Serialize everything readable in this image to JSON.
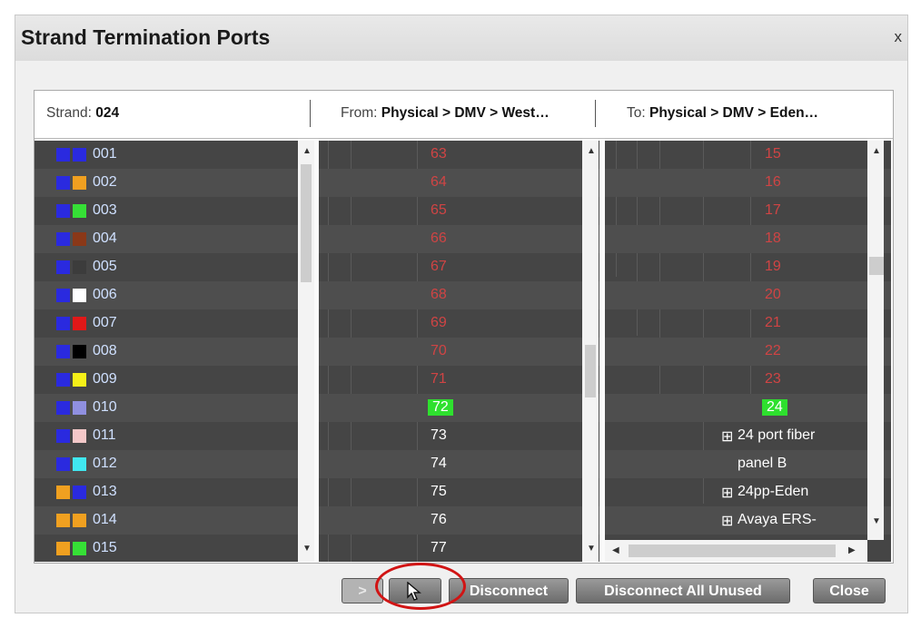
{
  "dialog": {
    "title": "Strand Termination Ports",
    "close_label": "x"
  },
  "header": {
    "strand_label": "Strand: ",
    "strand_value": "024",
    "from_label": "From: ",
    "from_value": "Physical > DMV > West…",
    "to_label": "To: ",
    "to_value": "Physical > DMV > Eden…"
  },
  "strands": [
    {
      "label": "001",
      "c1": "#2a2adf",
      "c2": "#2a2adf"
    },
    {
      "label": "002",
      "c1": "#2a2adf",
      "c2": "#f0a020"
    },
    {
      "label": "003",
      "c1": "#2a2adf",
      "c2": "#36e036"
    },
    {
      "label": "004",
      "c1": "#2a2adf",
      "c2": "#8a3818"
    },
    {
      "label": "005",
      "c1": "#2a2adf",
      "c2": "#3c3c3c"
    },
    {
      "label": "006",
      "c1": "#2a2adf",
      "c2": "#ffffff"
    },
    {
      "label": "007",
      "c1": "#2a2adf",
      "c2": "#e01818"
    },
    {
      "label": "008",
      "c1": "#2a2adf",
      "c2": "#000000"
    },
    {
      "label": "009",
      "c1": "#2a2adf",
      "c2": "#f6f018"
    },
    {
      "label": "010",
      "c1": "#2a2adf",
      "c2": "#9090e0"
    },
    {
      "label": "011",
      "c1": "#2a2adf",
      "c2": "#f4c8c8"
    },
    {
      "label": "012",
      "c1": "#2a2adf",
      "c2": "#40e8f0"
    },
    {
      "label": "013",
      "c1": "#f0a020",
      "c2": "#2a2adf"
    },
    {
      "label": "014",
      "c1": "#f0a020",
      "c2": "#f0a020"
    },
    {
      "label": "015",
      "c1": "#f0a020",
      "c2": "#36e036"
    }
  ],
  "from_ports": [
    {
      "label": "63",
      "state": "red"
    },
    {
      "label": "64",
      "state": "red"
    },
    {
      "label": "65",
      "state": "red"
    },
    {
      "label": "66",
      "state": "red"
    },
    {
      "label": "67",
      "state": "red"
    },
    {
      "label": "68",
      "state": "red"
    },
    {
      "label": "69",
      "state": "red"
    },
    {
      "label": "70",
      "state": "red"
    },
    {
      "label": "71",
      "state": "red"
    },
    {
      "label": "72",
      "state": "selected"
    },
    {
      "label": "73",
      "state": "free"
    },
    {
      "label": "74",
      "state": "free"
    },
    {
      "label": "75",
      "state": "free"
    },
    {
      "label": "76",
      "state": "free"
    },
    {
      "label": "77",
      "state": "free"
    }
  ],
  "to_ports": [
    {
      "label": "15",
      "state": "red"
    },
    {
      "label": "16",
      "state": "red"
    },
    {
      "label": "17",
      "state": "red"
    },
    {
      "label": "18",
      "state": "red"
    },
    {
      "label": "19",
      "state": "red"
    },
    {
      "label": "20",
      "state": "red"
    },
    {
      "label": "21",
      "state": "red"
    },
    {
      "label": "22",
      "state": "red"
    },
    {
      "label": "23",
      "state": "red"
    },
    {
      "label": "24",
      "state": "selected"
    }
  ],
  "to_tree": [
    {
      "label": "24 port fiber",
      "expand": "⊞"
    },
    {
      "label": "panel B",
      "expand": ""
    },
    {
      "label": "24pp-Eden",
      "expand": "⊞"
    },
    {
      "label": "Avaya ERS-",
      "expand": "⊞"
    }
  ],
  "buttons": {
    "connect": ">",
    "cursor_button": "",
    "disconnect": "Disconnect",
    "disconnect_all": "Disconnect All Unused",
    "close": "Close"
  },
  "colors": {
    "list_bg": "#454545",
    "row_alt": "#4e4e4e",
    "used_port": "#d04444",
    "selected_port": "#2ee02e"
  },
  "icons": {
    "scroll_up": "triangle-up",
    "scroll_down": "triangle-down",
    "scroll_left": "triangle-left",
    "scroll_right": "triangle-right",
    "cursor": "arrow-cursor"
  }
}
